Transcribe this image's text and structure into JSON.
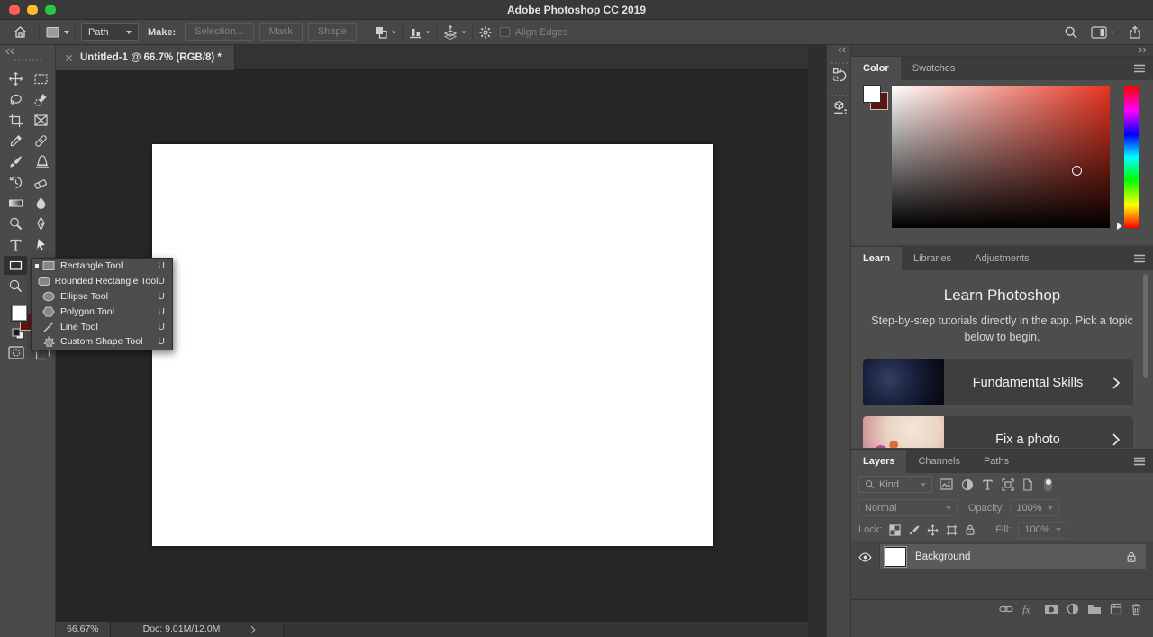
{
  "titlebar": {
    "title": "Adobe Photoshop CC 2019"
  },
  "options_bar": {
    "tool_mode_value": "Path",
    "make_label": "Make:",
    "selection_button": "Selection...",
    "mask_button": "Mask",
    "shape_button": "Shape",
    "align_edges_label": "Align Edges"
  },
  "toolbar": {
    "tools": [
      "move",
      "marquee",
      "lasso",
      "quick-select",
      "crop",
      "frame",
      "eyedropper",
      "healing",
      "brush",
      "clone-stamp",
      "history-brush",
      "eraser",
      "gradient",
      "blur",
      "dodge",
      "pen",
      "type",
      "path-select",
      "rectangle",
      "zoom"
    ],
    "selected_tool": "rectangle",
    "foreground_color": "#ffffff",
    "background_color": "#5e1511"
  },
  "tool_flyout": {
    "active_item": "Rectangle Tool",
    "items": [
      {
        "label": "Rectangle Tool",
        "shortcut": "U"
      },
      {
        "label": "Rounded Rectangle Tool",
        "shortcut": "U"
      },
      {
        "label": "Ellipse Tool",
        "shortcut": "U"
      },
      {
        "label": "Polygon Tool",
        "shortcut": "U"
      },
      {
        "label": "Line Tool",
        "shortcut": "U"
      },
      {
        "label": "Custom Shape Tool",
        "shortcut": "U"
      }
    ]
  },
  "document": {
    "tab_title": "Untitled-1 @ 66.7% (RGB/8) *",
    "status": {
      "zoom": "66.67%",
      "doc_size": "Doc: 9.01M/12.0M"
    }
  },
  "color_panel": {
    "tabs": [
      "Color",
      "Swatches"
    ],
    "active_tab": "Color",
    "hue": "red",
    "foreground_color": "#ffffff",
    "background_color": "#5e1511"
  },
  "learn_panel": {
    "tabs": [
      "Learn",
      "Libraries",
      "Adjustments"
    ],
    "active_tab": "Learn",
    "heading": "Learn Photoshop",
    "description": "Step-by-step tutorials directly in the app. Pick a topic below to begin.",
    "cards": [
      {
        "title": "Fundamental Skills"
      },
      {
        "title": "Fix a photo"
      }
    ]
  },
  "layers_panel": {
    "tabs": [
      "Layers",
      "Channels",
      "Paths"
    ],
    "active_tab": "Layers",
    "filter": {
      "kind_label": "Kind"
    },
    "blend": {
      "mode": "Normal",
      "opacity_label": "Opacity:",
      "opacity_value": "100%"
    },
    "lock": {
      "label": "Lock:",
      "fill_label": "Fill:",
      "fill_value": "100%"
    },
    "layers": [
      {
        "name": "Background",
        "visible": true,
        "locked": true
      }
    ]
  }
}
